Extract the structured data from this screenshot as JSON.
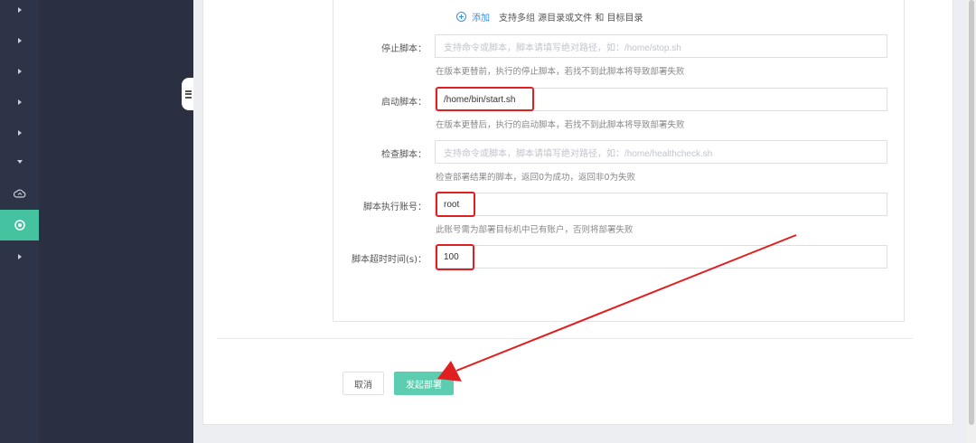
{
  "form": {
    "add": {
      "link_label": "添加",
      "hint": "支持多组 源目录或文件 和 目标目录"
    },
    "stop_script": {
      "label": "停止脚本：",
      "placeholder": "支持命令或脚本，脚本请填写绝对路径，如：/home/stop.sh",
      "hint": "在版本更替前，执行的停止脚本，若找不到此脚本将导致部署失败"
    },
    "start_script": {
      "label": "启动脚本：",
      "value": "/home/bin/start.sh",
      "hint": "在版本更替后，执行的启动脚本，若找不到此脚本将导致部署失败"
    },
    "check_script": {
      "label": "检查脚本：",
      "placeholder": "支持命令或脚本，脚本请填写绝对路径，如：/home/healthcheck.sh",
      "hint": "检查部署结果的脚本，返回0为成功，返回非0为失败"
    },
    "run_account": {
      "label": "脚本执行账号：",
      "value": "root",
      "hint": "此账号需为部署目标机中已有账户，否则将部署失败"
    },
    "timeout": {
      "label": "脚本超时时间(s)：",
      "value": "100"
    }
  },
  "actions": {
    "cancel_label": "取消",
    "deploy_label": "发起部署"
  },
  "sidebar": {
    "icons": [
      "expand-arrow-icon",
      "expand-arrow-icon",
      "expand-arrow-icon",
      "expand-arrow-icon",
      "expand-arrow-icon",
      "collapse-arrow-icon",
      "cloud-icon",
      "target-icon",
      "expand-arrow-icon"
    ],
    "active_item": "target-icon"
  },
  "colors": {
    "accent": "#45c3a0",
    "deploy_button": "#5ccdb0",
    "link": "#3a8ee6",
    "annotation": "#e02020",
    "sidebar_dark": "#2e3448"
  }
}
